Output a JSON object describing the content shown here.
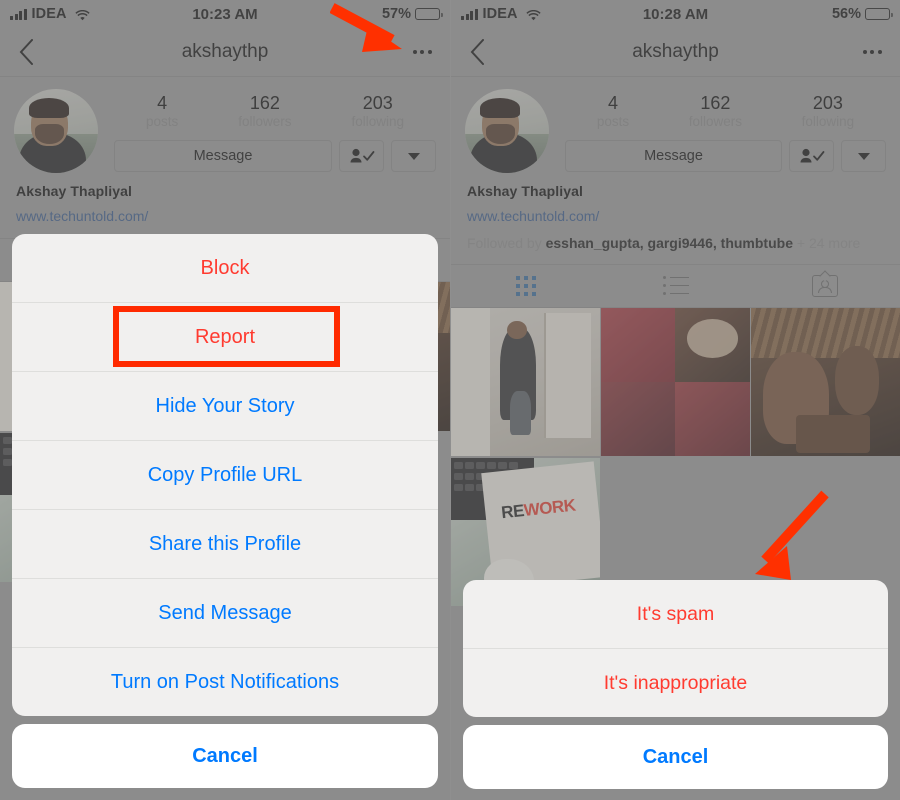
{
  "panels": [
    {
      "id": "left",
      "status_bar": {
        "carrier": "IDEA",
        "time": "10:23 AM",
        "battery_percent": "57%"
      },
      "nav": {
        "title": "akshaythp",
        "back_icon": "chevron-left-icon",
        "more_icon": "more-options-icon"
      },
      "profile": {
        "name": "Akshay Thapliyal",
        "website": "www.techuntold.com/",
        "followed_by": null,
        "stats": [
          {
            "value": "4",
            "label": "posts"
          },
          {
            "value": "162",
            "label": "followers"
          },
          {
            "value": "203",
            "label": "following"
          }
        ],
        "message_button": "Message",
        "following_icon": "person-check-icon",
        "dropdown_icon": "chevron-down-icon"
      },
      "sheet": {
        "items": [
          {
            "label": "Block",
            "style": "red"
          },
          {
            "label": "Report",
            "style": "red"
          },
          {
            "label": "Hide Your Story",
            "style": "blue"
          },
          {
            "label": "Copy Profile URL",
            "style": "blue"
          },
          {
            "label": "Share this Profile",
            "style": "blue"
          },
          {
            "label": "Send Message",
            "style": "blue"
          },
          {
            "label": "Turn on Post Notifications",
            "style": "blue"
          }
        ],
        "cancel": "Cancel",
        "highlighted_item": "Report"
      }
    },
    {
      "id": "right",
      "status_bar": {
        "carrier": "IDEA",
        "time": "10:28 AM",
        "battery_percent": "56%"
      },
      "nav": {
        "title": "akshaythp",
        "back_icon": "chevron-left-icon",
        "more_icon": "more-options-icon"
      },
      "profile": {
        "name": "Akshay Thapliyal",
        "website": "www.techuntold.com/",
        "followed_by_prefix": "Followed by",
        "followed_by_names": "esshan_gupta, gargi9446, thumbtube",
        "followed_by_suffix": "+ 24 more",
        "stats": [
          {
            "value": "4",
            "label": "posts"
          },
          {
            "value": "162",
            "label": "followers"
          },
          {
            "value": "203",
            "label": "following"
          }
        ],
        "message_button": "Message",
        "following_icon": "person-check-icon",
        "dropdown_icon": "chevron-down-icon"
      },
      "tabs": [
        {
          "icon": "grid-view-icon",
          "active": true
        },
        {
          "icon": "list-view-icon",
          "active": false
        },
        {
          "icon": "tagged-photos-icon",
          "active": false
        }
      ],
      "sheet": {
        "items": [
          {
            "label": "It's spam",
            "style": "red"
          },
          {
            "label": "It's inappropriate",
            "style": "red"
          }
        ],
        "cancel": "Cancel"
      }
    }
  ],
  "annotations": {
    "arrow_color": "#ff3000",
    "highlight_color": "#ff2a00"
  }
}
